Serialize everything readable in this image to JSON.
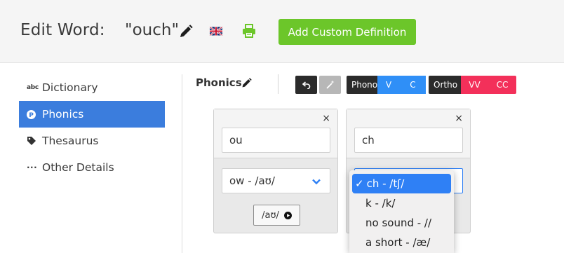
{
  "header": {
    "title": "Edit Word:",
    "word": "\"ouch\"",
    "add_definition_label": "Add Custom Definition",
    "icons": [
      "pencil-icon",
      "uk-flag-icon",
      "printer-icon"
    ],
    "colors": {
      "add_button": "#6cc62a",
      "printer": "#6cc62a"
    }
  },
  "sidebar": {
    "items": [
      {
        "label": "Dictionary",
        "icon": "abc-icon",
        "active": false
      },
      {
        "label": "Phonics",
        "icon": "phonics-p-icon",
        "active": true
      },
      {
        "label": "Thesaurus",
        "icon": "tag-icon",
        "active": false
      },
      {
        "label": "Other Details",
        "icon": "ellipsis-icon",
        "active": false
      }
    ],
    "active_color": "#3b7ddd"
  },
  "phonics": {
    "title": "Phonics",
    "toolbar": {
      "phono_label": "Phono",
      "phono_v": "V",
      "phono_c": "C",
      "ortho_label": "Ortho",
      "ortho_vv": "VV",
      "ortho_cc": "CC",
      "colors": {
        "dark": "#2b2b2b",
        "blue": "#2f8ff7",
        "red": "#f3305a",
        "magic": "#b7b7b7"
      }
    },
    "cards": [
      {
        "close": "×",
        "grapheme": "ou",
        "sound": "ow - /aʊ/",
        "sound_button": "/aʊ/"
      },
      {
        "close": "×",
        "grapheme": "ch",
        "sound": ""
      }
    ],
    "dropdown": {
      "options": [
        {
          "label": "ch - /tʃ/",
          "selected": true,
          "check": "✓"
        },
        {
          "label": "k - /k/",
          "selected": false
        },
        {
          "label": "no sound - //",
          "selected": false
        },
        {
          "label": "a short - /æ/",
          "selected": false
        }
      ]
    }
  }
}
